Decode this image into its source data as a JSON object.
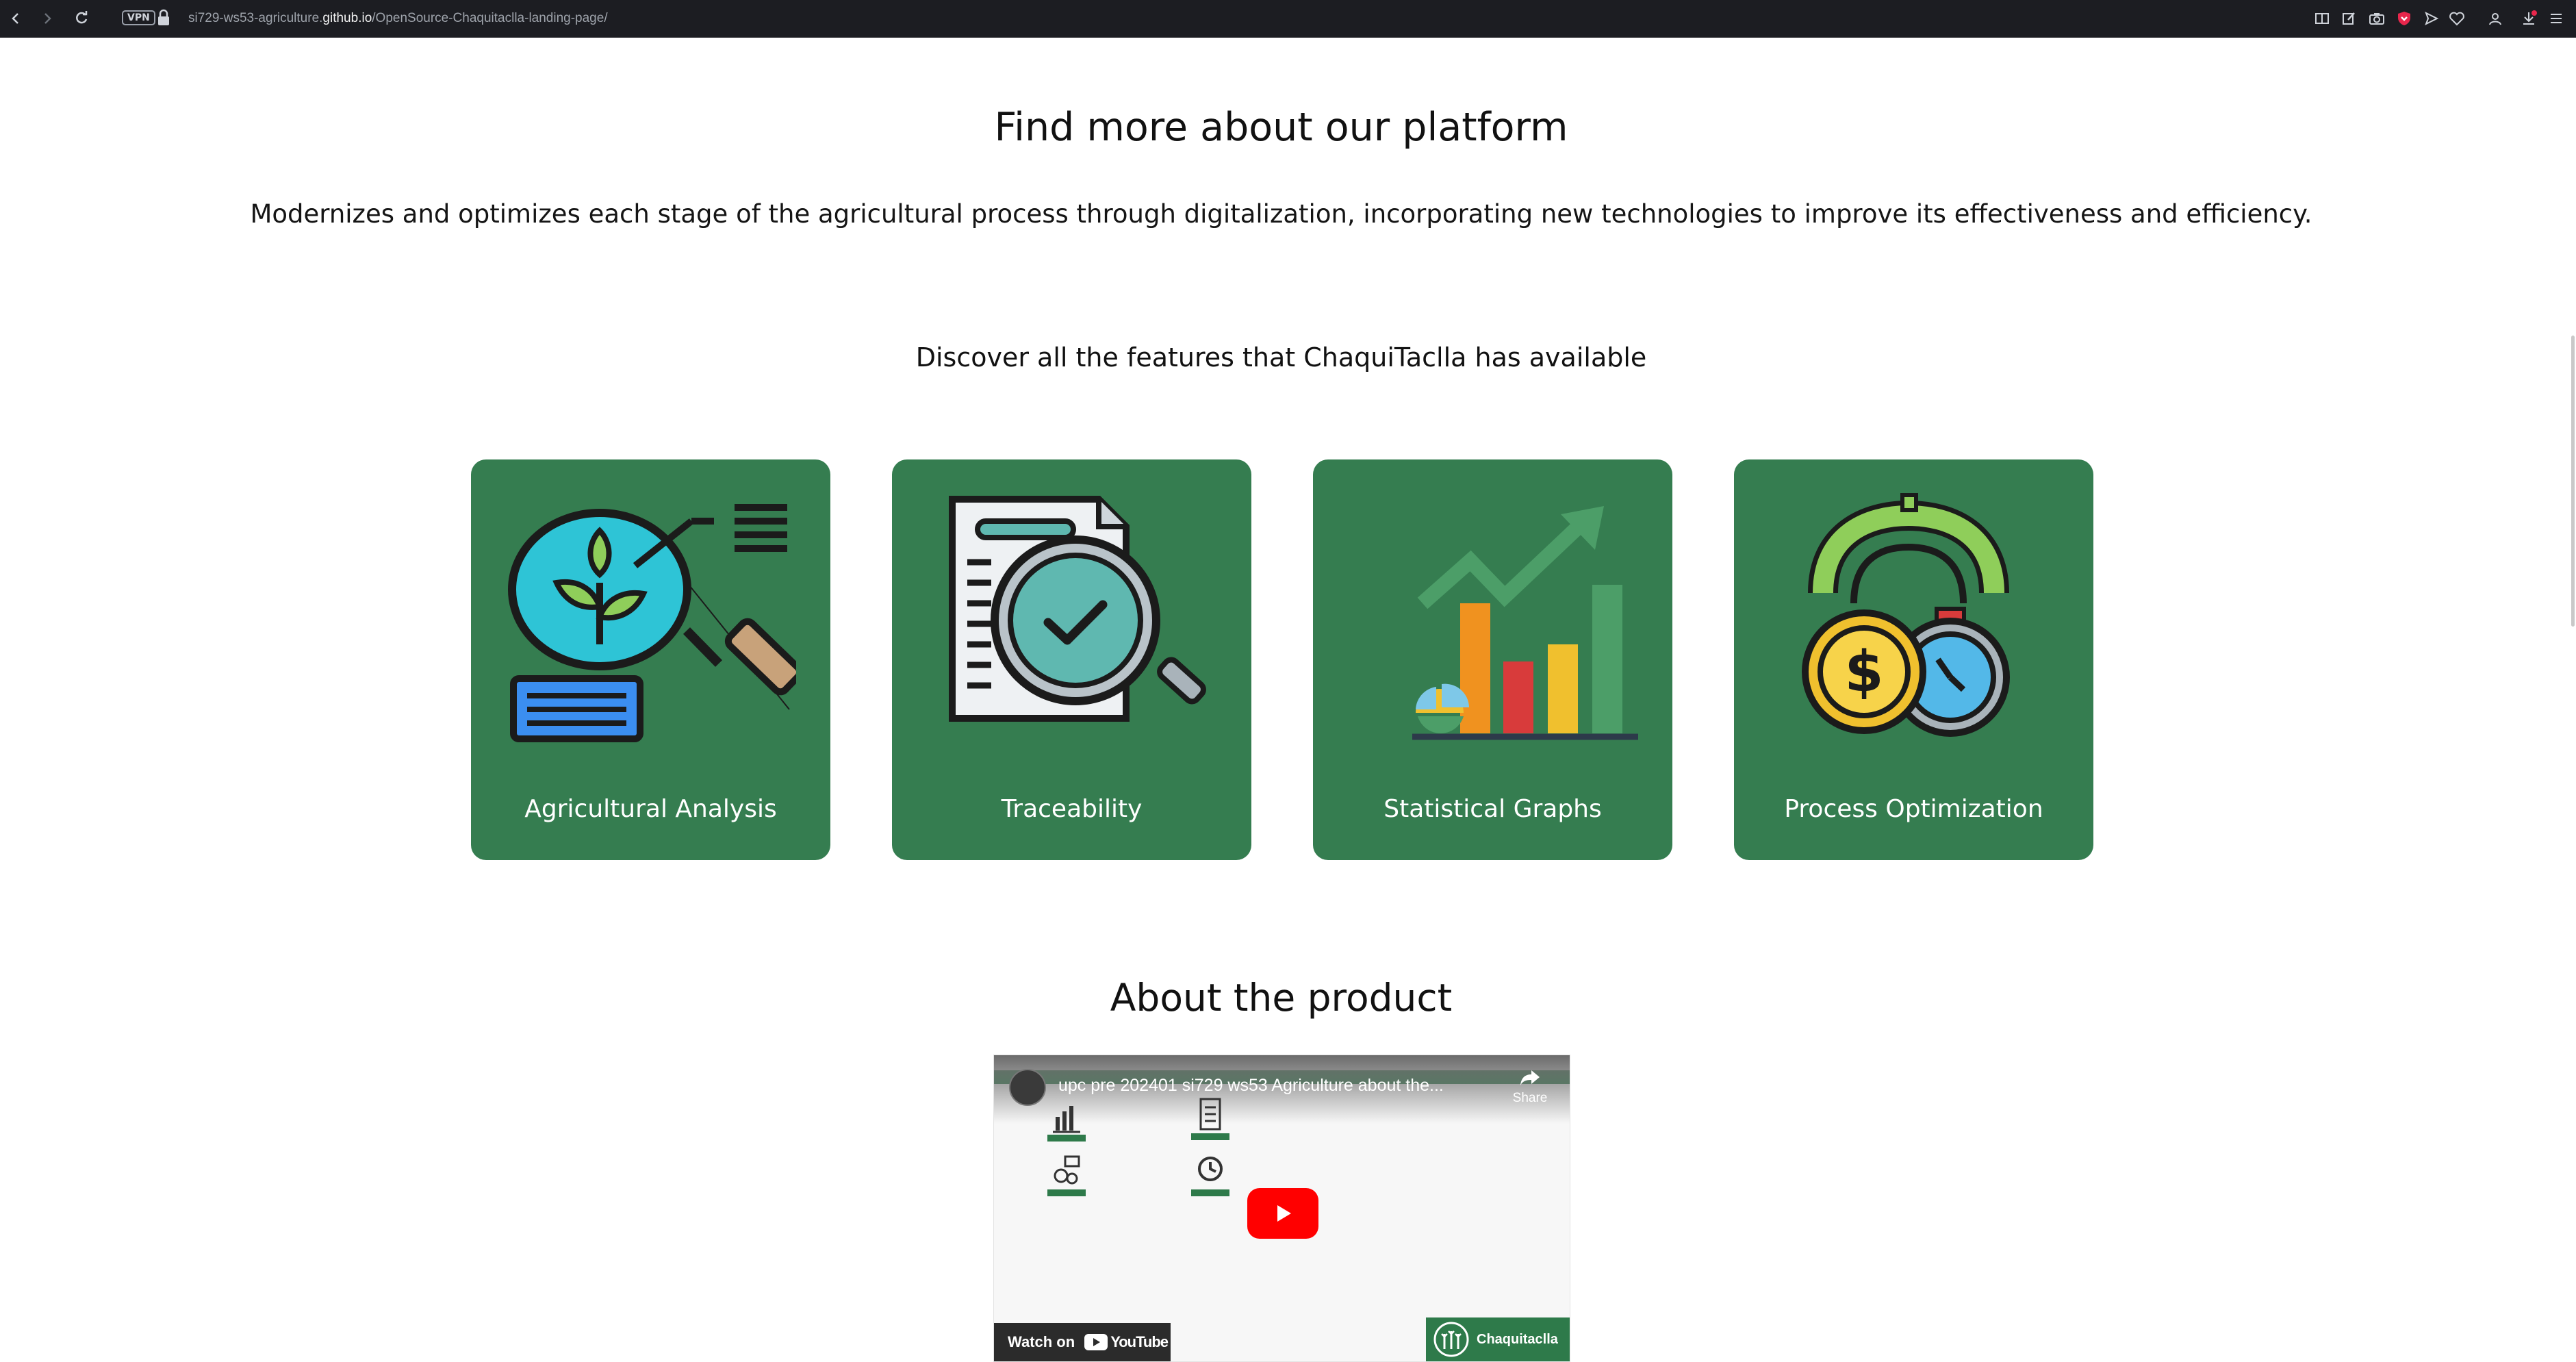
{
  "browser": {
    "vpn_label": "VPN",
    "url_prefix": "si729-ws53-agriculture.",
    "url_host": "github.io",
    "url_path": "/OpenSource-Chaquitaclla-landing-page/"
  },
  "platform": {
    "title": "Find more about our platform",
    "description": "Modernizes and optimizes each stage of the agricultural process through digitalization, incorporating new technologies to improve its effectiveness and efficiency.",
    "features_heading": "Discover all the features that ChaquiTaclla has available",
    "card_color": "#357d50",
    "features": [
      {
        "label": "Agricultural Analysis",
        "icon": "plant-magnifier-icon"
      },
      {
        "label": "Traceability",
        "icon": "document-magnifier-icon"
      },
      {
        "label": "Statistical Graphs",
        "icon": "bar-chart-icon"
      },
      {
        "label": "Process Optimization",
        "icon": "stopwatch-coin-icon"
      }
    ]
  },
  "product": {
    "title": "About the product",
    "video": {
      "title": "upc pre 202401 si729 ws53 Agriculture about the...",
      "share_label": "Share",
      "watch_label": "Watch on",
      "youtube_label": "YouTube",
      "brand_label": "Chaquitaclla"
    }
  }
}
